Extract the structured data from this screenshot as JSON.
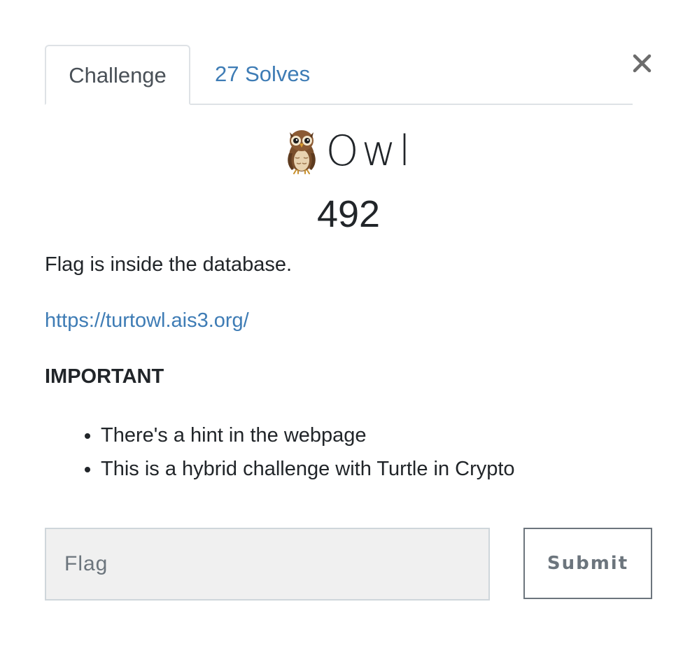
{
  "modal": {
    "close_symbol": "×",
    "tabs": [
      {
        "label": "Challenge",
        "active": true
      },
      {
        "label": "27 Solves",
        "active": false
      }
    ],
    "challenge": {
      "icon": "owl-emoji",
      "name": "Owl",
      "points": "492",
      "description": "Flag is inside the database.",
      "link": "https://turtowl.ais3.org/",
      "important_heading": "IMPORTANT",
      "hints": [
        "There's a hint in the webpage",
        "This is a hybrid challenge with Turtle in Crypto"
      ]
    },
    "flag_form": {
      "placeholder": "Flag",
      "value": "",
      "submit_label": "Submit"
    }
  },
  "colors": {
    "link": "#3e7cb5",
    "text": "#212529",
    "muted": "#6c757d",
    "input_bg": "#f0f0f0",
    "tab_border": "#dee2e6"
  }
}
